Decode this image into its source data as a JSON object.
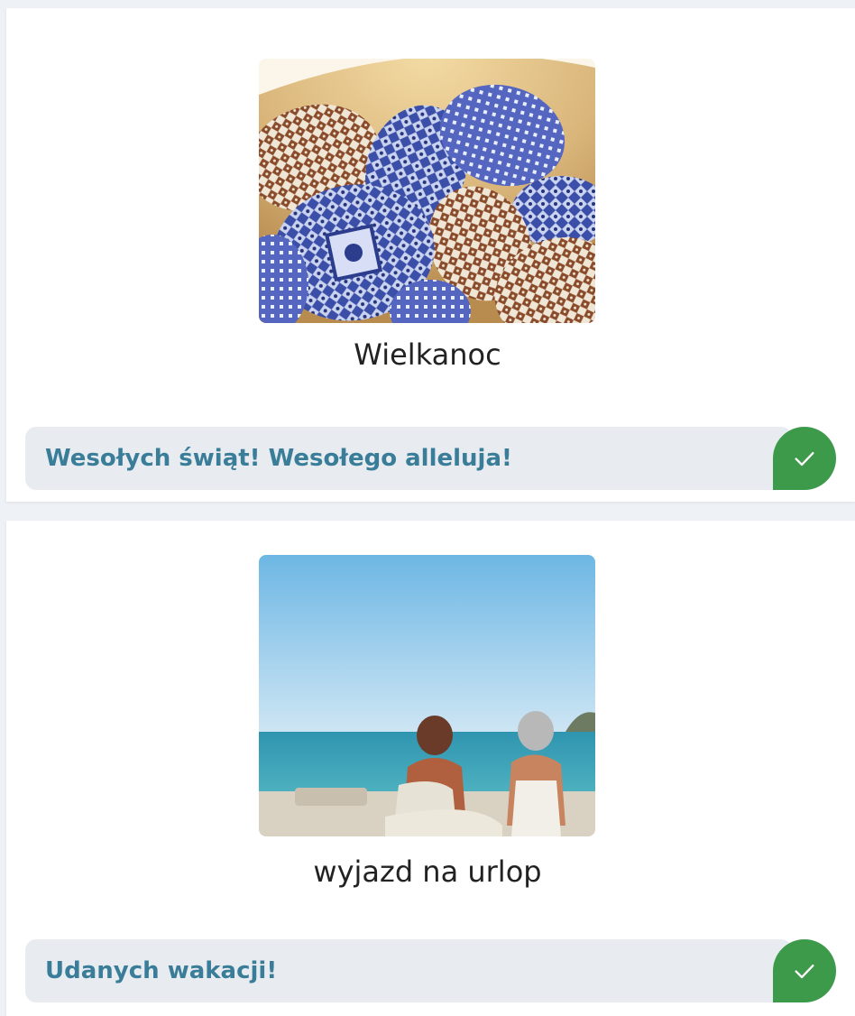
{
  "cards": [
    {
      "caption": "Wielkanoc",
      "image": "easter-eggs-photo",
      "message": "Wesołych świąt! Wesołego alleluja!",
      "action_icon": "check-icon"
    },
    {
      "caption": "wyjazd na urlop",
      "image": "beach-vacation-photo",
      "message": "Udanych wakacji!",
      "action_icon": "check-icon"
    }
  ],
  "colors": {
    "accent_text": "#3a7d99",
    "bubble_bg": "#e8ecf1",
    "check_bg": "#3d9a4a"
  }
}
